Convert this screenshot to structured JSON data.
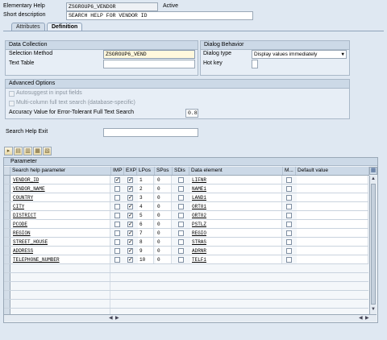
{
  "header": {
    "elementary_help_label": "Elementary Help",
    "elementary_help_value": "ZSGROUP6_VENDOR",
    "status": "Active",
    "short_desc_label": "Short description",
    "short_desc_value": "SEARCH HELP FOR VENDOR ID"
  },
  "tabs": [
    {
      "label": "Attributes"
    },
    {
      "label": "Definition"
    }
  ],
  "data_collection": {
    "title": "Data Collection",
    "selection_method_label": "Selection Method",
    "selection_method_value": "ZSGROUP6_VEND",
    "text_table_label": "Text Table",
    "text_table_value": ""
  },
  "dialog_behavior": {
    "title": "Dialog Behavior",
    "dialog_type_label": "Dialog type",
    "dialog_type_value": "Display values immediately",
    "hot_key_label": "Hot key",
    "hot_key_value": ""
  },
  "advanced": {
    "title": "Advanced Options",
    "autosuggest_label": "Autosuggest in input fields",
    "multicolumn_label": "Multi-column full text search (database-specific)",
    "accuracy_label": "Accuracy Value for Error-Tolerant Full Text Search",
    "accuracy_value": "0.8"
  },
  "search_help_exit": {
    "label": "Search Help Exit",
    "value": ""
  },
  "parameter_table": {
    "title": "Parameter",
    "columns": [
      "Search help parameter",
      "IMP",
      "EXP",
      "LPos",
      "SPos",
      "SDis",
      "Data element",
      "M...",
      "Default value"
    ],
    "rows": [
      {
        "param": "VENDOR_ID",
        "imp": true,
        "exp": true,
        "lpos": "1",
        "spos": "0",
        "sdis": false,
        "element": "LIFNR",
        "mod": false
      },
      {
        "param": "VENDOR_NAME",
        "imp": false,
        "exp": true,
        "lpos": "2",
        "spos": "0",
        "sdis": false,
        "element": "NAME1",
        "mod": false
      },
      {
        "param": "COUNTRY",
        "imp": false,
        "exp": true,
        "lpos": "3",
        "spos": "0",
        "sdis": false,
        "element": "LAND1",
        "mod": false
      },
      {
        "param": "CITY",
        "imp": false,
        "exp": true,
        "lpos": "4",
        "spos": "0",
        "sdis": false,
        "element": "ORT01",
        "mod": false
      },
      {
        "param": "DISTRICT",
        "imp": false,
        "exp": true,
        "lpos": "5",
        "spos": "0",
        "sdis": false,
        "element": "ORT02",
        "mod": false
      },
      {
        "param": "PCODE",
        "imp": false,
        "exp": true,
        "lpos": "6",
        "spos": "0",
        "sdis": false,
        "element": "PSTLZ",
        "mod": false
      },
      {
        "param": "REGION",
        "imp": false,
        "exp": true,
        "lpos": "7",
        "spos": "0",
        "sdis": false,
        "element": "REGIO",
        "mod": false
      },
      {
        "param": "STREET_HOUSE",
        "imp": false,
        "exp": true,
        "lpos": "8",
        "spos": "0",
        "sdis": false,
        "element": "STRAS",
        "mod": false
      },
      {
        "param": "ADDRESS",
        "imp": false,
        "exp": true,
        "lpos": "9",
        "spos": "0",
        "sdis": false,
        "element": "ADRNR",
        "mod": false
      },
      {
        "param": "TELEPHONE_NUMBER",
        "imp": false,
        "exp": true,
        "lpos": "10",
        "spos": "0",
        "sdis": false,
        "element": "TELF1",
        "mod": false
      }
    ],
    "empty_rows": 6
  },
  "colors": {
    "background": "#dfe8f2",
    "group_header": "#ccd9e7",
    "field_border": "#9aa8b7"
  }
}
